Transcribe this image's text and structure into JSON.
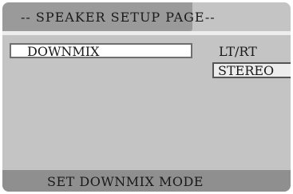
{
  "header": {
    "title": "-- SPEAKER SETUP PAGE--"
  },
  "menu": {
    "items": [
      {
        "label": "DOWNMIX",
        "selected": true
      }
    ]
  },
  "options": {
    "items": [
      {
        "label": "LT/RT",
        "highlighted": false
      },
      {
        "label": "STEREO",
        "highlighted": true
      }
    ]
  },
  "status": {
    "text": "SET DOWNMIX MODE"
  }
}
